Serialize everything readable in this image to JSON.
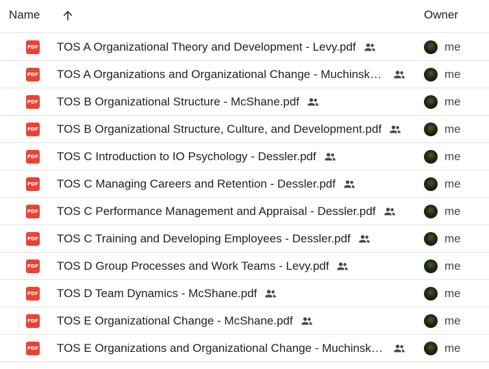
{
  "header": {
    "name_label": "Name",
    "sort_icon": "arrow-up-icon",
    "owner_label": "Owner"
  },
  "colors": {
    "pdf_badge": "#ea4335",
    "divider": "#e3e3e3",
    "text": "#1f1f1f"
  },
  "files": [
    {
      "name": "TOS A Organizational Theory and Development - Levy.pdf",
      "type_label": "PDF",
      "shared": true,
      "owner": "me"
    },
    {
      "name": "TOS A Organizations and Organizational Change - Muchinsky.pdf",
      "type_label": "PDF",
      "shared": true,
      "owner": "me"
    },
    {
      "name": "TOS B Organizational Structure - McShane.pdf",
      "type_label": "PDF",
      "shared": true,
      "owner": "me"
    },
    {
      "name": "TOS B Organizational Structure, Culture, and Development.pdf",
      "type_label": "PDF",
      "shared": true,
      "owner": "me"
    },
    {
      "name": "TOS C Introduction to IO Psychology - Dessler.pdf",
      "type_label": "PDF",
      "shared": true,
      "owner": "me"
    },
    {
      "name": "TOS C Managing Careers and Retention - Dessler.pdf",
      "type_label": "PDF",
      "shared": true,
      "owner": "me"
    },
    {
      "name": "TOS C Performance Management and Appraisal - Dessler.pdf",
      "type_label": "PDF",
      "shared": true,
      "owner": "me"
    },
    {
      "name": "TOS C Training and Developing Employees - Dessler.pdf",
      "type_label": "PDF",
      "shared": true,
      "owner": "me"
    },
    {
      "name": "TOS D Group Processes and Work Teams - Levy.pdf",
      "type_label": "PDF",
      "shared": true,
      "owner": "me"
    },
    {
      "name": "TOS D Team Dynamics - McShane.pdf",
      "type_label": "PDF",
      "shared": true,
      "owner": "me"
    },
    {
      "name": "TOS E Organizational Change - McShane.pdf",
      "type_label": "PDF",
      "shared": true,
      "owner": "me"
    },
    {
      "name": "TOS E Organizations and Organizational Change - Muchinsky.pdf",
      "type_label": "PDF",
      "shared": true,
      "owner": "me"
    }
  ]
}
